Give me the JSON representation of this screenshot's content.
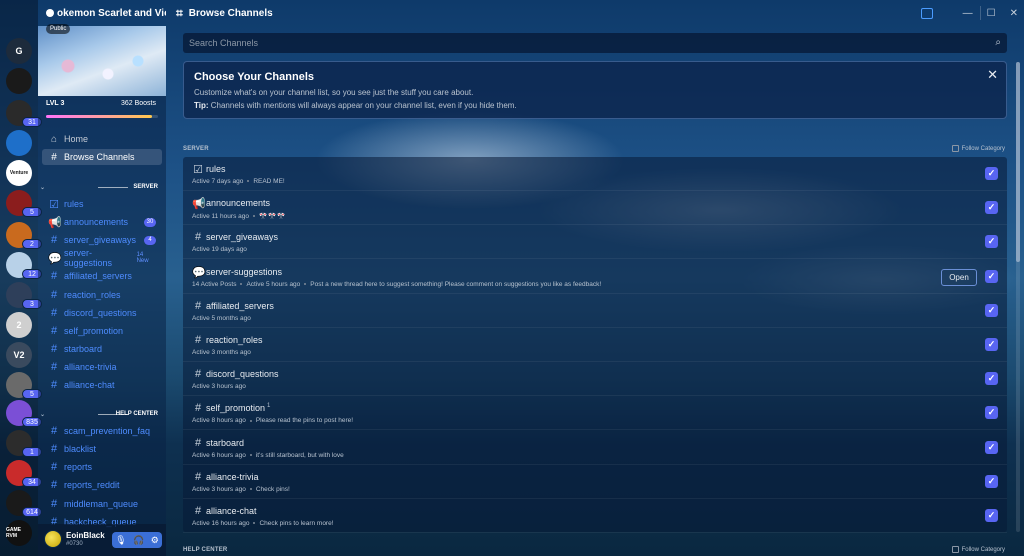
{
  "window": {
    "server_name": "okemon Scarlet and Violet",
    "page_title": "Browse Channels",
    "controls": {
      "minimize": "—",
      "maximize": "☐",
      "close": "✕"
    }
  },
  "rail": {
    "servers": [
      {
        "label": "G",
        "color": "#1d2b3c",
        "badge": ""
      },
      {
        "label": "",
        "color": "#1a1a1a",
        "badge": ""
      },
      {
        "label": "",
        "color": "#2a2a2a",
        "badge": "31"
      },
      {
        "label": "",
        "color": "#1e6fc9",
        "badge": ""
      },
      {
        "label": "Venture",
        "color": "#ffffff",
        "badge": ""
      },
      {
        "label": "",
        "color": "#8b1d1d",
        "badge": "5"
      },
      {
        "label": "",
        "color": "#c96a1e",
        "badge": "2"
      },
      {
        "label": "",
        "color": "#b8d1e8",
        "badge": "12"
      },
      {
        "label": "",
        "color": "#2e3f5a",
        "badge": "3"
      },
      {
        "label": "2",
        "color": "#cfcfcf",
        "badge": ""
      },
      {
        "label": "V2",
        "color": "#3a4a5e",
        "badge": ""
      },
      {
        "label": "",
        "color": "#6a6a6a",
        "badge": "5"
      },
      {
        "label": "",
        "color": "#7b4fd6",
        "badge": "835"
      },
      {
        "label": "",
        "color": "#2c2c2c",
        "badge": "1"
      },
      {
        "label": "",
        "color": "#c92b2b",
        "badge": "34"
      },
      {
        "label": "",
        "color": "#1a1a1a",
        "badge": "614"
      },
      {
        "label": "GAME RVM",
        "color": "#111111",
        "badge": ""
      }
    ]
  },
  "sidebar": {
    "public_label": "Public",
    "level": "LVL 3",
    "boosts": "362 Boosts",
    "boost_progress": 0.95,
    "nav": [
      {
        "icon": "⌂",
        "label": "Home",
        "active": false
      },
      {
        "icon": "#",
        "label": "Browse Channels",
        "active": true
      }
    ],
    "categories": [
      {
        "name": "SERVER",
        "channels": [
          {
            "icon": "☑",
            "name": "rules",
            "count": "",
            "new": ""
          },
          {
            "icon": "📢",
            "name": "announcements",
            "count": "30",
            "new": ""
          },
          {
            "icon": "#",
            "name": "server_giveaways",
            "count": "4",
            "new": ""
          },
          {
            "icon": "💬",
            "name": "server-suggestions",
            "count": "",
            "new": "14 New"
          },
          {
            "icon": "#",
            "name": "affiliated_servers",
            "count": "",
            "new": ""
          },
          {
            "icon": "#",
            "name": "reaction_roles",
            "count": "",
            "new": ""
          },
          {
            "icon": "#",
            "name": "discord_questions",
            "count": "",
            "new": ""
          },
          {
            "icon": "#",
            "name": "self_promotion",
            "count": "",
            "new": ""
          },
          {
            "icon": "#",
            "name": "starboard",
            "count": "",
            "new": ""
          },
          {
            "icon": "#",
            "name": "alliance-trivia",
            "count": "",
            "new": ""
          },
          {
            "icon": "#",
            "name": "alliance-chat",
            "count": "",
            "new": ""
          }
        ]
      },
      {
        "name": "HELP CENTER",
        "channels": [
          {
            "icon": "#",
            "name": "scam_prevention_faq",
            "count": "",
            "new": ""
          },
          {
            "icon": "#",
            "name": "blacklist",
            "count": "",
            "new": ""
          },
          {
            "icon": "#",
            "name": "reports",
            "count": "",
            "new": ""
          },
          {
            "icon": "#",
            "name": "reports_reddit",
            "count": "",
            "new": ""
          },
          {
            "icon": "#",
            "name": "middleman_queue",
            "count": "",
            "new": ""
          },
          {
            "icon": "#",
            "name": "hackcheck_queue",
            "count": "",
            "new": ""
          }
        ]
      }
    ]
  },
  "user": {
    "name": "EoinBlack",
    "tag": "#0730"
  },
  "main": {
    "search_placeholder": "Search Channels",
    "info": {
      "title": "Choose Your Channels",
      "description": "Customize what's on your channel list, so you see just the stuff you care about.",
      "tip_label": "Tip:",
      "tip_text": "Channels with mentions will always appear on your channel list, even if you hide them."
    },
    "section_server": "SERVER",
    "section_help": "HELP CENTER",
    "follow_category": "Follow Category",
    "open_label": "Open",
    "channels": [
      {
        "icon": "☑",
        "name": "rules",
        "activity": "Active 7 days ago",
        "extra": "READ ME!",
        "sup": "",
        "flags": "",
        "open": false,
        "followed": true
      },
      {
        "icon": "📢",
        "name": "announcements",
        "activity": "Active 11 hours ago",
        "extra": "",
        "sup": "",
        "flags": "🎌🎌🎌",
        "open": false,
        "followed": true
      },
      {
        "icon": "#",
        "name": "server_giveaways",
        "activity": "Active 19 days ago",
        "extra": "",
        "sup": "",
        "flags": "",
        "open": false,
        "followed": true
      },
      {
        "icon": "💬",
        "name": "server-suggestions",
        "activity": "14 Active Posts",
        "activity2": "Active 5 hours ago",
        "extra": "Post a new thread here to suggest something! Please comment on suggestions you like as feedback!",
        "sup": "",
        "flags": "",
        "open": true,
        "followed": true
      },
      {
        "icon": "#",
        "name": "affiliated_servers",
        "activity": "Active 5 months ago",
        "extra": "",
        "sup": "",
        "flags": "",
        "open": false,
        "followed": true
      },
      {
        "icon": "#",
        "name": "reaction_roles",
        "activity": "Active 3 months ago",
        "extra": "",
        "sup": "",
        "flags": "",
        "open": false,
        "followed": true
      },
      {
        "icon": "#",
        "name": "discord_questions",
        "activity": "Active 3 hours ago",
        "extra": "",
        "sup": "",
        "flags": "",
        "open": false,
        "followed": true
      },
      {
        "icon": "#",
        "name": "self_promotion",
        "activity": "Active 8 hours ago",
        "extra": "Please read the pins to post here!",
        "sup": "1",
        "flags": "",
        "open": false,
        "followed": true
      },
      {
        "icon": "#",
        "name": "starboard",
        "activity": "Active 6 hours ago",
        "extra": "it's still starboard, but with love",
        "sup": "",
        "flags": "",
        "open": false,
        "followed": true
      },
      {
        "icon": "#",
        "name": "alliance-trivia",
        "activity": "Active 3 hours ago",
        "extra": "Check pins!",
        "sup": "",
        "flags": "",
        "open": false,
        "followed": true
      },
      {
        "icon": "#",
        "name": "alliance-chat",
        "activity": "Active 16 hours ago",
        "extra": "Check pins to learn more!",
        "sup": "",
        "flags": "",
        "open": false,
        "followed": true
      }
    ]
  }
}
